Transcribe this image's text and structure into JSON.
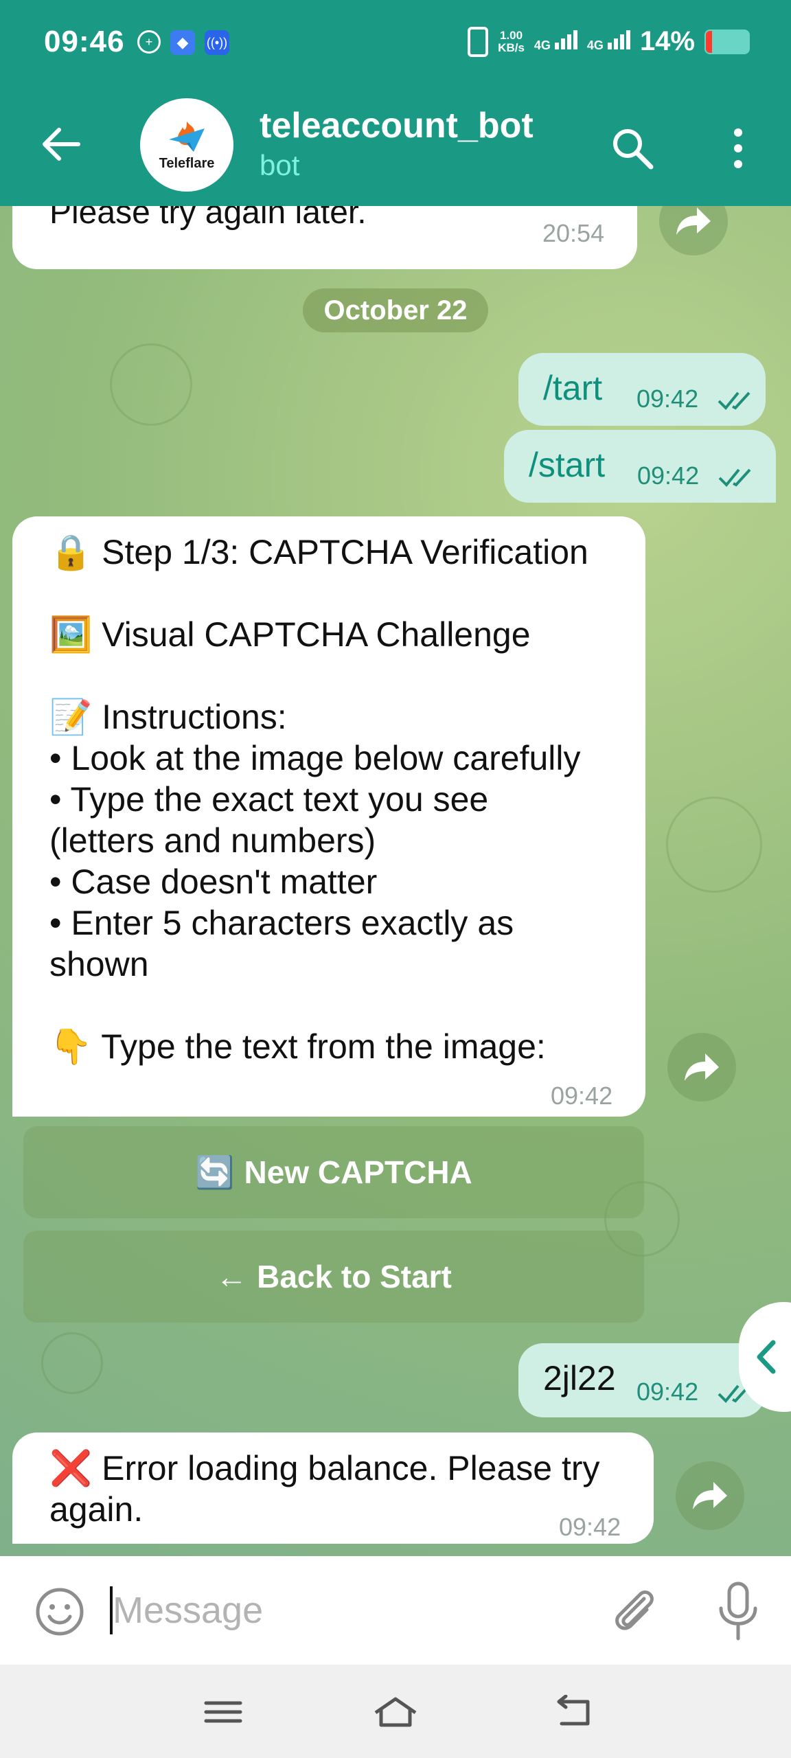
{
  "status_bar": {
    "time": "09:46",
    "speed_value": "1.00",
    "speed_unit": "KB/s",
    "net1": "4G",
    "net2": "4G",
    "battery_pct": "14%",
    "battery_level": 0.14,
    "battery_color": "#ff3b30"
  },
  "header": {
    "title": "teleaccount_bot",
    "subtitle": "bot",
    "avatar_text": "Teleflare",
    "color": "#1a9a84"
  },
  "chat": {
    "date_separator": "October 22",
    "messages": [
      {
        "type": "in",
        "lines": [
          "Please try again later."
        ],
        "time": "20:54"
      },
      {
        "type": "out",
        "text": "/tart",
        "time": "09:42",
        "status": "read"
      },
      {
        "type": "out",
        "text": "/start",
        "time": "09:42",
        "status": "read"
      },
      {
        "type": "in",
        "lines": [
          "🔒 Step 1/3: CAPTCHA Verification",
          "",
          "🖼️ Visual CAPTCHA Challenge",
          "",
          "📝 Instructions:",
          "• Look at the image below carefully",
          "• Type the exact text you see",
          "(letters and numbers)",
          "• Case doesn't matter",
          "• Enter 5 characters exactly as",
          "shown",
          "",
          "👇 Type the text from the image:"
        ],
        "time": "09:42"
      },
      {
        "type": "out",
        "text": "2jl22",
        "time": "09:42",
        "status": "read"
      },
      {
        "type": "in",
        "lines": [
          "❌ Error loading balance. Please try",
          "again."
        ],
        "time": "09:42"
      }
    ],
    "keyboard_buttons": [
      {
        "icon": "🔄",
        "label": "New CAPTCHA"
      },
      {
        "icon": "←",
        "label": "Back to Start"
      }
    ]
  },
  "input": {
    "placeholder": "Message"
  }
}
